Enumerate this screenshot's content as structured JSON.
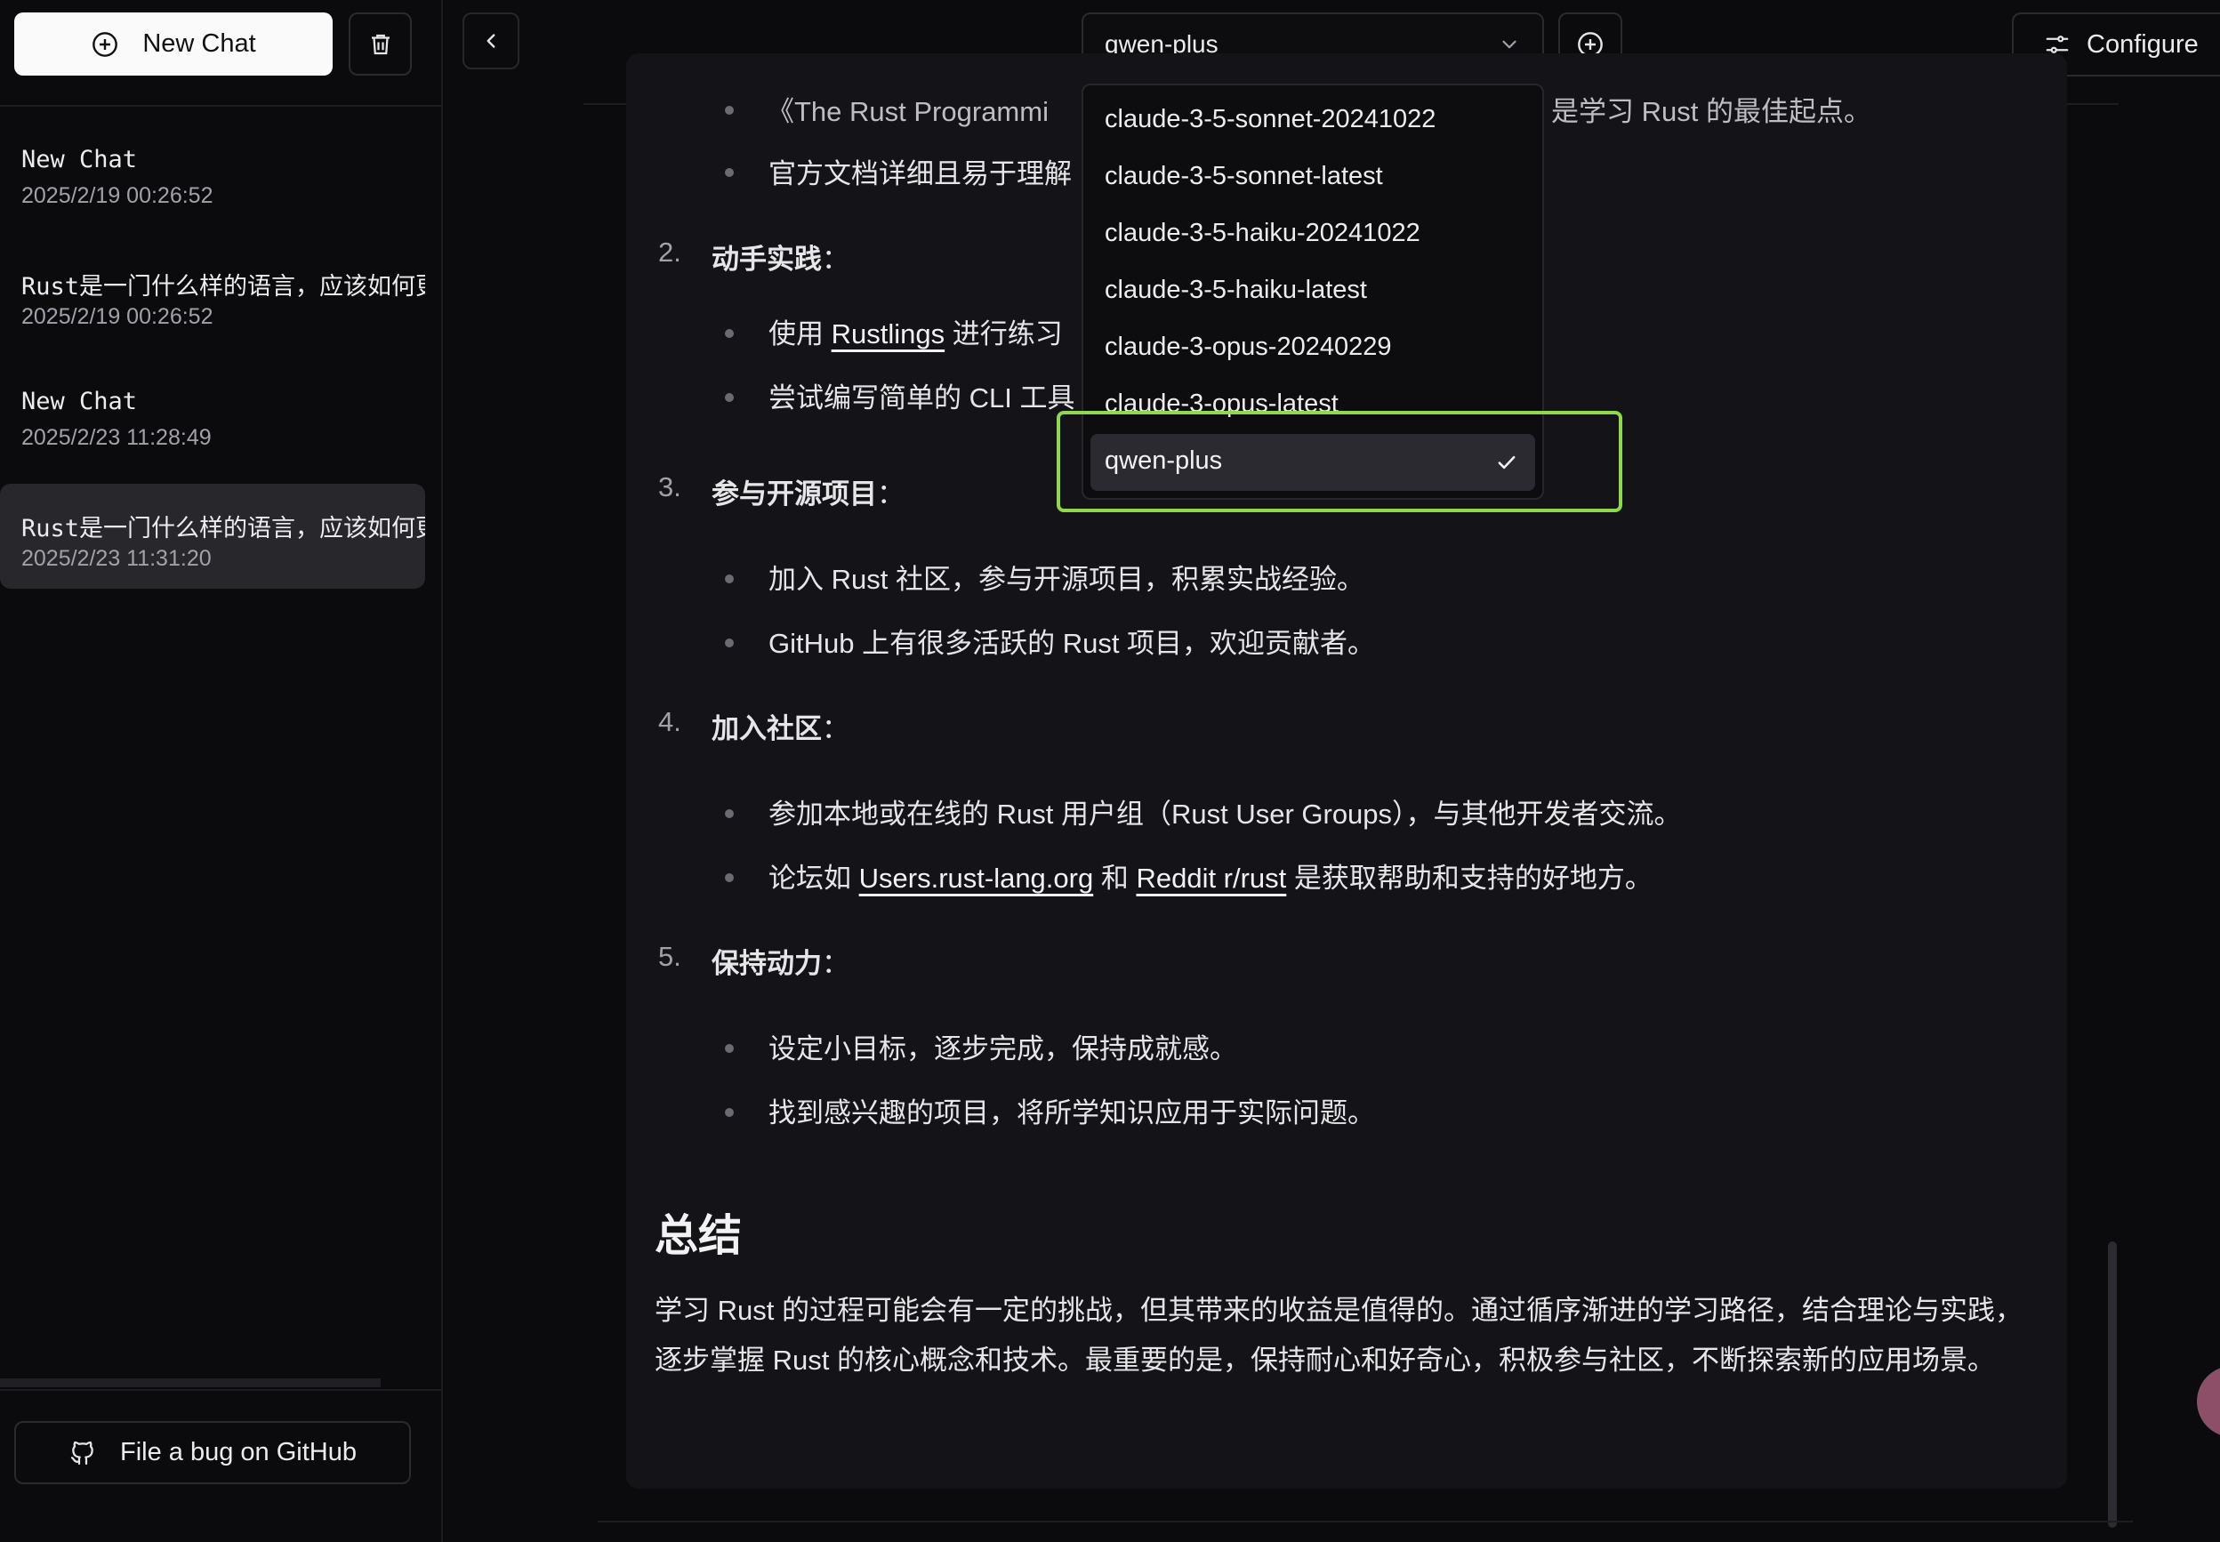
{
  "sidebar": {
    "new_chat_label": "New Chat",
    "chats": [
      {
        "title": "New Chat",
        "date": "2025/2/19 00:26:52"
      },
      {
        "title": "Rust是一门什么样的语言，应该如何更",
        "date": "2025/2/19 00:26:52"
      },
      {
        "title": "New Chat",
        "date": "2025/2/23 11:28:49"
      },
      {
        "title": "Rust是一门什么样的语言，应该如何更",
        "date": "2025/2/23 11:31:20",
        "active": true
      }
    ],
    "bug_label": "File a bug on GitHub"
  },
  "topbar": {
    "model_selected": "qwen-plus",
    "configure_label": "Configure"
  },
  "model_dropdown": {
    "options": [
      "claude-3-5-sonnet-20241022",
      "claude-3-5-sonnet-latest",
      "claude-3-5-haiku-20241022",
      "claude-3-5-haiku-latest",
      "claude-3-opus-20240229",
      "claude-3-opus-latest",
      "qwen-plus"
    ],
    "selected": "qwen-plus"
  },
  "content": {
    "partial_top_left": "《The Rust Programmi",
    "partial_top_right": "是学习 Rust 的最佳起点。",
    "partial_doc": "官方文档详细且易于理解",
    "s2": {
      "num": "2.",
      "heading": "动手实践",
      "colon": "：",
      "b1_pre": "使用 ",
      "b1_link": "Rustlings",
      "b1_post": " 进行练习",
      "b2": "尝试编写简单的 CLI 工具"
    },
    "s3": {
      "num": "3.",
      "heading": "参与开源项目",
      "colon": "：",
      "b1": "加入 Rust 社区，参与开源项目，积累实战经验。",
      "b2": "GitHub 上有很多活跃的 Rust 项目，欢迎贡献者。"
    },
    "s4": {
      "num": "4.",
      "heading": "加入社区",
      "colon": "：",
      "b1": "参加本地或在线的 Rust 用户组（Rust User Groups），与其他开发者交流。",
      "b2_pre": "论坛如 ",
      "b2_link1": "Users.rust-lang.org",
      "b2_mid": " 和 ",
      "b2_link2": "Reddit r/rust",
      "b2_post": " 是获取帮助和支持的好地方。"
    },
    "s5": {
      "num": "5.",
      "heading": "保持动力",
      "colon": "：",
      "b1": "设定小目标，逐步完成，保持成就感。",
      "b2": "找到感兴趣的项目，将所学知识应用于实际问题。"
    },
    "summary_heading": "总结",
    "summary_text": "学习 Rust 的过程可能会有一定的挑战，但其带来的收益是值得的。通过循序渐进的学习路径，结合理论与实践，逐步掌握 Rust 的核心概念和技术。最重要的是，保持耐心和好奇心，积极参与社区，不断探索新的应用场景。"
  }
}
